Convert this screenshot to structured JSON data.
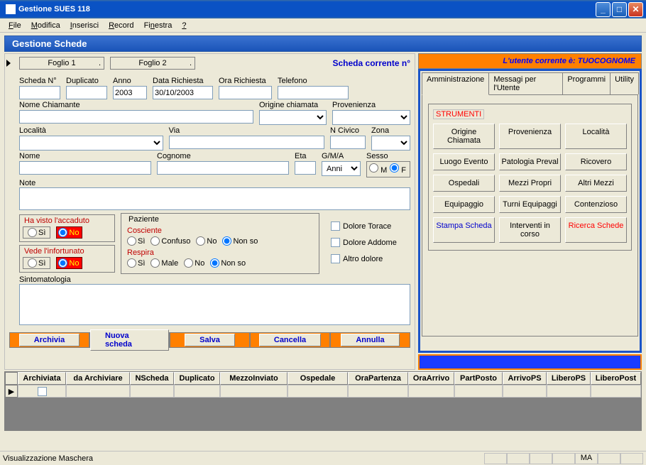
{
  "window": {
    "title": "Gestione SUES 118"
  },
  "menu": [
    "File",
    "Modifica",
    "Inserisci",
    "Record",
    "Finestra",
    "?"
  ],
  "subheader": "Gestione Schede",
  "sheet_tabs": [
    "Foglio 1",
    "Foglio 2"
  ],
  "top": {
    "scheda_corrente": "Scheda corrente n°",
    "user_banner": "L'utente corrente è: TUOCOGNOME"
  },
  "fields": {
    "scheda_n": "Scheda N°",
    "duplicato": "Duplicato",
    "anno": "Anno",
    "anno_val": "2003",
    "data_richiesta": "Data Richiesta",
    "data_richiesta_val": "30/10/2003",
    "ora_richiesta": "Ora Richiesta",
    "telefono": "Telefono",
    "nome_chiamante": "Nome Chiamante",
    "origine_chiamata": "Origine chiamata",
    "provenienza": "Provenienza",
    "localita": "Località",
    "via": "Via",
    "n_civico": "N Civico",
    "zona": "Zona",
    "nome": "Nome",
    "cognome": "Cognome",
    "eta": "Eta",
    "gma": "G/M/A",
    "gma_val": "Anni",
    "sesso": "Sesso",
    "sesso_m": "M",
    "sesso_f": "F",
    "note": "Note",
    "sintomatologia": "Sintomatologia"
  },
  "accaduto": {
    "label": "Ha visto l'accaduto",
    "si": "Sì",
    "no": "No"
  },
  "infortunato": {
    "label": "Vede l'infortunato",
    "si": "Sì",
    "no": "No"
  },
  "paziente": {
    "label": "Paziente",
    "cosciente": "Cosciente",
    "c_si": "Sì",
    "c_confuso": "Confuso",
    "c_no": "No",
    "c_nonso": "Non so",
    "respira": "Respira",
    "r_si": "Sì",
    "r_male": "Male",
    "r_no": "No",
    "r_nonso": "Non so"
  },
  "dolore": {
    "torace": "Dolore Torace",
    "addome": "Dolore Addome",
    "altro": "Altro dolore"
  },
  "actions": {
    "archivia": "Archivia",
    "nuova": "Nuova scheda",
    "salva": "Salva",
    "cancella": "Cancella",
    "annulla": "Annulla"
  },
  "rtabs": [
    "Amministrazione",
    "Messagi per l'Utente",
    "Programmi",
    "Utility"
  ],
  "tools_label": "STRUMENTI",
  "tools": [
    "Origine Chiamata",
    "Provenienza",
    "Località",
    "Luogo Evento",
    "Patologia Preval",
    "Ricovero",
    "Ospedali",
    "Mezzi Propri",
    "Altri Mezzi",
    "Equipaggio",
    "Turni Equipaggi",
    "Contenzioso",
    "Stampa Scheda",
    "Interventi in corso",
    "Ricerca Schede"
  ],
  "grid_headers": [
    "Archiviata",
    "da Archiviare",
    "NScheda",
    "Duplicato",
    "MezzoInviato",
    "Ospedale",
    "OraPartenza",
    "OraArrivo",
    "PartPosto",
    "ArrivoPS",
    "LiberoPS",
    "LiberoPost"
  ],
  "status": {
    "text": "Visualizzazione Maschera",
    "mode": "MA"
  }
}
